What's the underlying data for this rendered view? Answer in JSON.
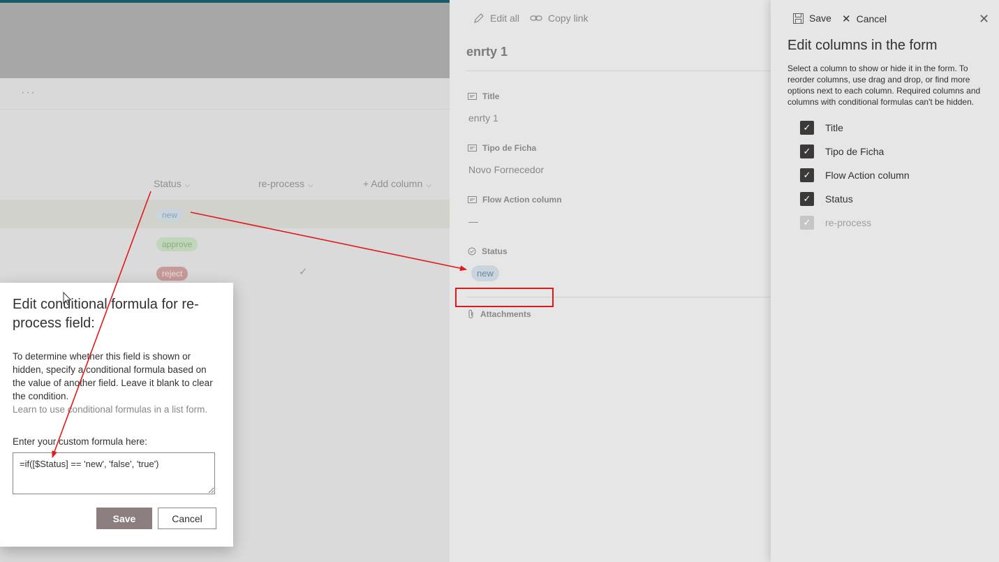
{
  "list": {
    "more_label": "···",
    "columns": [
      {
        "label": "Status",
        "chevron": "⌵"
      },
      {
        "label": "re-process",
        "chevron": "⌵"
      },
      {
        "label": "+ Add column",
        "chevron": "⌵"
      }
    ],
    "rows": [
      {
        "status": "new"
      },
      {
        "status": "approve"
      },
      {
        "status": "reject",
        "reprocess": "✓"
      }
    ]
  },
  "item_panel": {
    "commands": {
      "edit_all": "Edit all",
      "copy_link": "Copy link"
    },
    "title": "enrty 1",
    "fields": [
      {
        "label": "Title",
        "value": "enrty 1"
      },
      {
        "label": "Tipo de Ficha",
        "value": "Novo Fornecedor"
      },
      {
        "label": "Flow Action column",
        "value": "—"
      },
      {
        "label": "Status",
        "value": "new"
      },
      {
        "label": "Attachments",
        "value": ""
      }
    ]
  },
  "columns_panel": {
    "save_label": "Save",
    "cancel_label": "Cancel",
    "close_glyph": "✕",
    "title": "Edit columns in the form",
    "description": "Select a column to show or hide it in the form. To reorder columns, use drag and drop, or find more options next to each column. Required columns and columns with conditional formulas can't be hidden.",
    "items": [
      {
        "label": "Title",
        "checked": true,
        "disabled": false
      },
      {
        "label": "Tipo de Ficha",
        "checked": true,
        "disabled": false
      },
      {
        "label": "Flow Action column",
        "checked": true,
        "disabled": false
      },
      {
        "label": "Status",
        "checked": true,
        "disabled": false
      },
      {
        "label": "re-process",
        "checked": true,
        "disabled": true
      }
    ]
  },
  "dialog": {
    "title": "Edit conditional formula for re-process field:",
    "description": "To determine whether this field is shown or hidden, specify a conditional formula based on the value of another field. Leave it blank to clear the condition.",
    "link": "Learn to use conditional formulas in a list form.",
    "input_label": "Enter your custom formula here:",
    "formula": "=if([$Status] == 'new', 'false', 'true')",
    "save_label": "Save",
    "cancel_label": "Cancel"
  },
  "colors": {
    "annotation": "#e3181b",
    "accent": "#0078d4"
  }
}
